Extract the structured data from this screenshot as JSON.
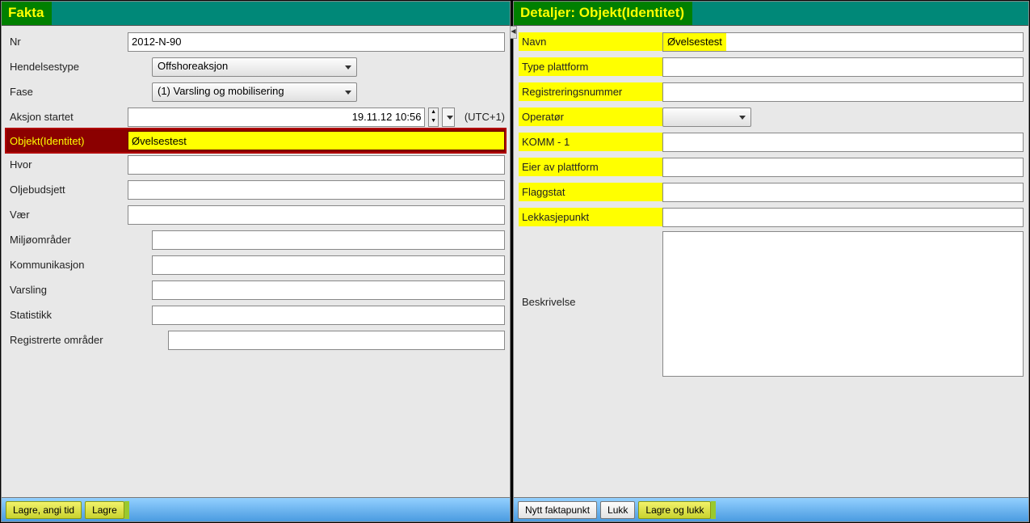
{
  "left": {
    "title": "Fakta",
    "fields": {
      "nr_label": "Nr",
      "nr_value": "2012-N-90",
      "hendelsestype_label": "Hendelsestype",
      "hendelsestype_value": "Offshoreaksjon",
      "fase_label": "Fase",
      "fase_value": "(1) Varsling og mobilisering",
      "aksjon_label": "Aksjon startet",
      "aksjon_value": "19.11.12 10:56",
      "tz": "(UTC+1)",
      "objekt_label": "Objekt(Identitet)",
      "objekt_value": "Øvelsestest",
      "hvor_label": "Hvor",
      "olje_label": "Oljebudsjett",
      "vaer_label": "Vær",
      "miljo_label": "Miljøområder",
      "komm_label": "Kommunikasjon",
      "varsling_label": "Varsling",
      "stat_label": "Statistikk",
      "regomr_label": "Registrerte områder"
    },
    "buttons": {
      "lagre_angi": "Lagre, angi tid",
      "lagre": "Lagre"
    }
  },
  "right": {
    "title": "Detaljer: Objekt(Identitet)",
    "fields": {
      "navn_label": "Navn",
      "navn_value": "Øvelsestest",
      "type_label": "Type plattform",
      "regnr_label": "Registreringsnummer",
      "operator_label": "Operatør",
      "komm1_label": "KOMM - 1",
      "eier_label": "Eier av plattform",
      "flagg_label": "Flaggstat",
      "lekk_label": "Lekkasjepunkt",
      "besk_label": "Beskrivelse"
    },
    "buttons": {
      "nytt": "Nytt faktapunkt",
      "lukk": "Lukk",
      "lagrelukk": "Lagre og lukk"
    }
  }
}
